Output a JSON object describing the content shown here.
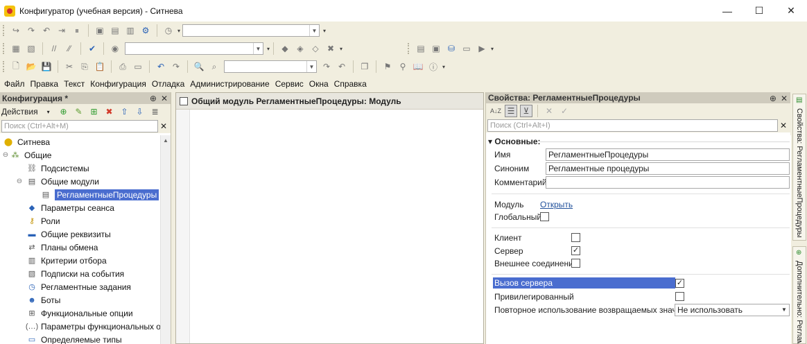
{
  "window": {
    "title": "Конфигуратор (учебная версия) - Ситнева",
    "controls": {
      "minimize": "—",
      "maximize": "☐",
      "close": "✕"
    }
  },
  "menu": {
    "items": [
      "Файл",
      "Правка",
      "Текст",
      "Конфигурация",
      "Отладка",
      "Администрирование",
      "Сервис",
      "Окна",
      "Справка"
    ]
  },
  "left_panel": {
    "title": "Конфигурация *",
    "actions_label": "Действия",
    "search_placeholder": "Поиск (Ctrl+Alt+M)",
    "tree": [
      {
        "label": "Ситнева",
        "icon": "config-icon",
        "level": 0,
        "expander": ""
      },
      {
        "label": "Общие",
        "icon": "common-icon",
        "level": 0,
        "expander": "⊖"
      },
      {
        "label": "Подсистемы",
        "icon": "subsystems-icon",
        "level": 1,
        "expander": ""
      },
      {
        "label": "Общие модули",
        "icon": "modules-icon",
        "level": 1,
        "expander": "⊖"
      },
      {
        "label": "РегламентныеПроцедуры",
        "icon": "module-icon",
        "level": 2,
        "expander": "",
        "selected": true
      },
      {
        "label": "Параметры сеанса",
        "icon": "session-params-icon",
        "level": 1,
        "expander": ""
      },
      {
        "label": "Роли",
        "icon": "roles-icon",
        "level": 1,
        "expander": ""
      },
      {
        "label": "Общие реквизиты",
        "icon": "attributes-icon",
        "level": 1,
        "expander": ""
      },
      {
        "label": "Планы обмена",
        "icon": "exchange-plans-icon",
        "level": 1,
        "expander": ""
      },
      {
        "label": "Критерии отбора",
        "icon": "filter-criteria-icon",
        "level": 1,
        "expander": ""
      },
      {
        "label": "Подписки на события",
        "icon": "event-subscriptions-icon",
        "level": 1,
        "expander": ""
      },
      {
        "label": "Регламентные задания",
        "icon": "scheduled-jobs-icon",
        "level": 1,
        "expander": ""
      },
      {
        "label": "Боты",
        "icon": "bots-icon",
        "level": 1,
        "expander": ""
      },
      {
        "label": "Функциональные опции",
        "icon": "functional-options-icon",
        "level": 1,
        "expander": ""
      },
      {
        "label": "Параметры функциональных опц",
        "icon": "functional-params-icon",
        "level": 1,
        "expander": ""
      },
      {
        "label": "Определяемые типы",
        "icon": "defined-types-icon",
        "level": 1,
        "expander": ""
      }
    ]
  },
  "editor": {
    "title": "Общий модуль РегламентныеПроцедуры: Модуль"
  },
  "properties": {
    "title": "Свойства: РегламентныеПроцедуры",
    "search_placeholder": "Поиск (Ctrl+Alt+I)",
    "section": "Основные:",
    "name_label": "Имя",
    "name_value": "РегламентныеПроцедуры",
    "synonym_label": "Синоним",
    "synonym_value": "Регламентные процедуры",
    "comment_label": "Комментарий",
    "comment_value": "",
    "module_label": "Модуль",
    "module_link": "Открыть",
    "global_label": "Глобальный",
    "client_label": "Клиент",
    "server_label": "Сервер",
    "external_label": "Внешнее соединение",
    "server_call_label": "Вызов сервера",
    "privileged_label": "Привилегированный",
    "reuse_label": "Повторное использование возвращаемых значени",
    "reuse_value": "Не использовать",
    "checks": {
      "global": false,
      "client": false,
      "server": true,
      "external": false,
      "server_call": true,
      "privileged": false
    }
  },
  "side_tabs": {
    "tab1": "Свойства: РегламентныеПроцедуры",
    "tab2": "Дополнительно: Регламе"
  }
}
